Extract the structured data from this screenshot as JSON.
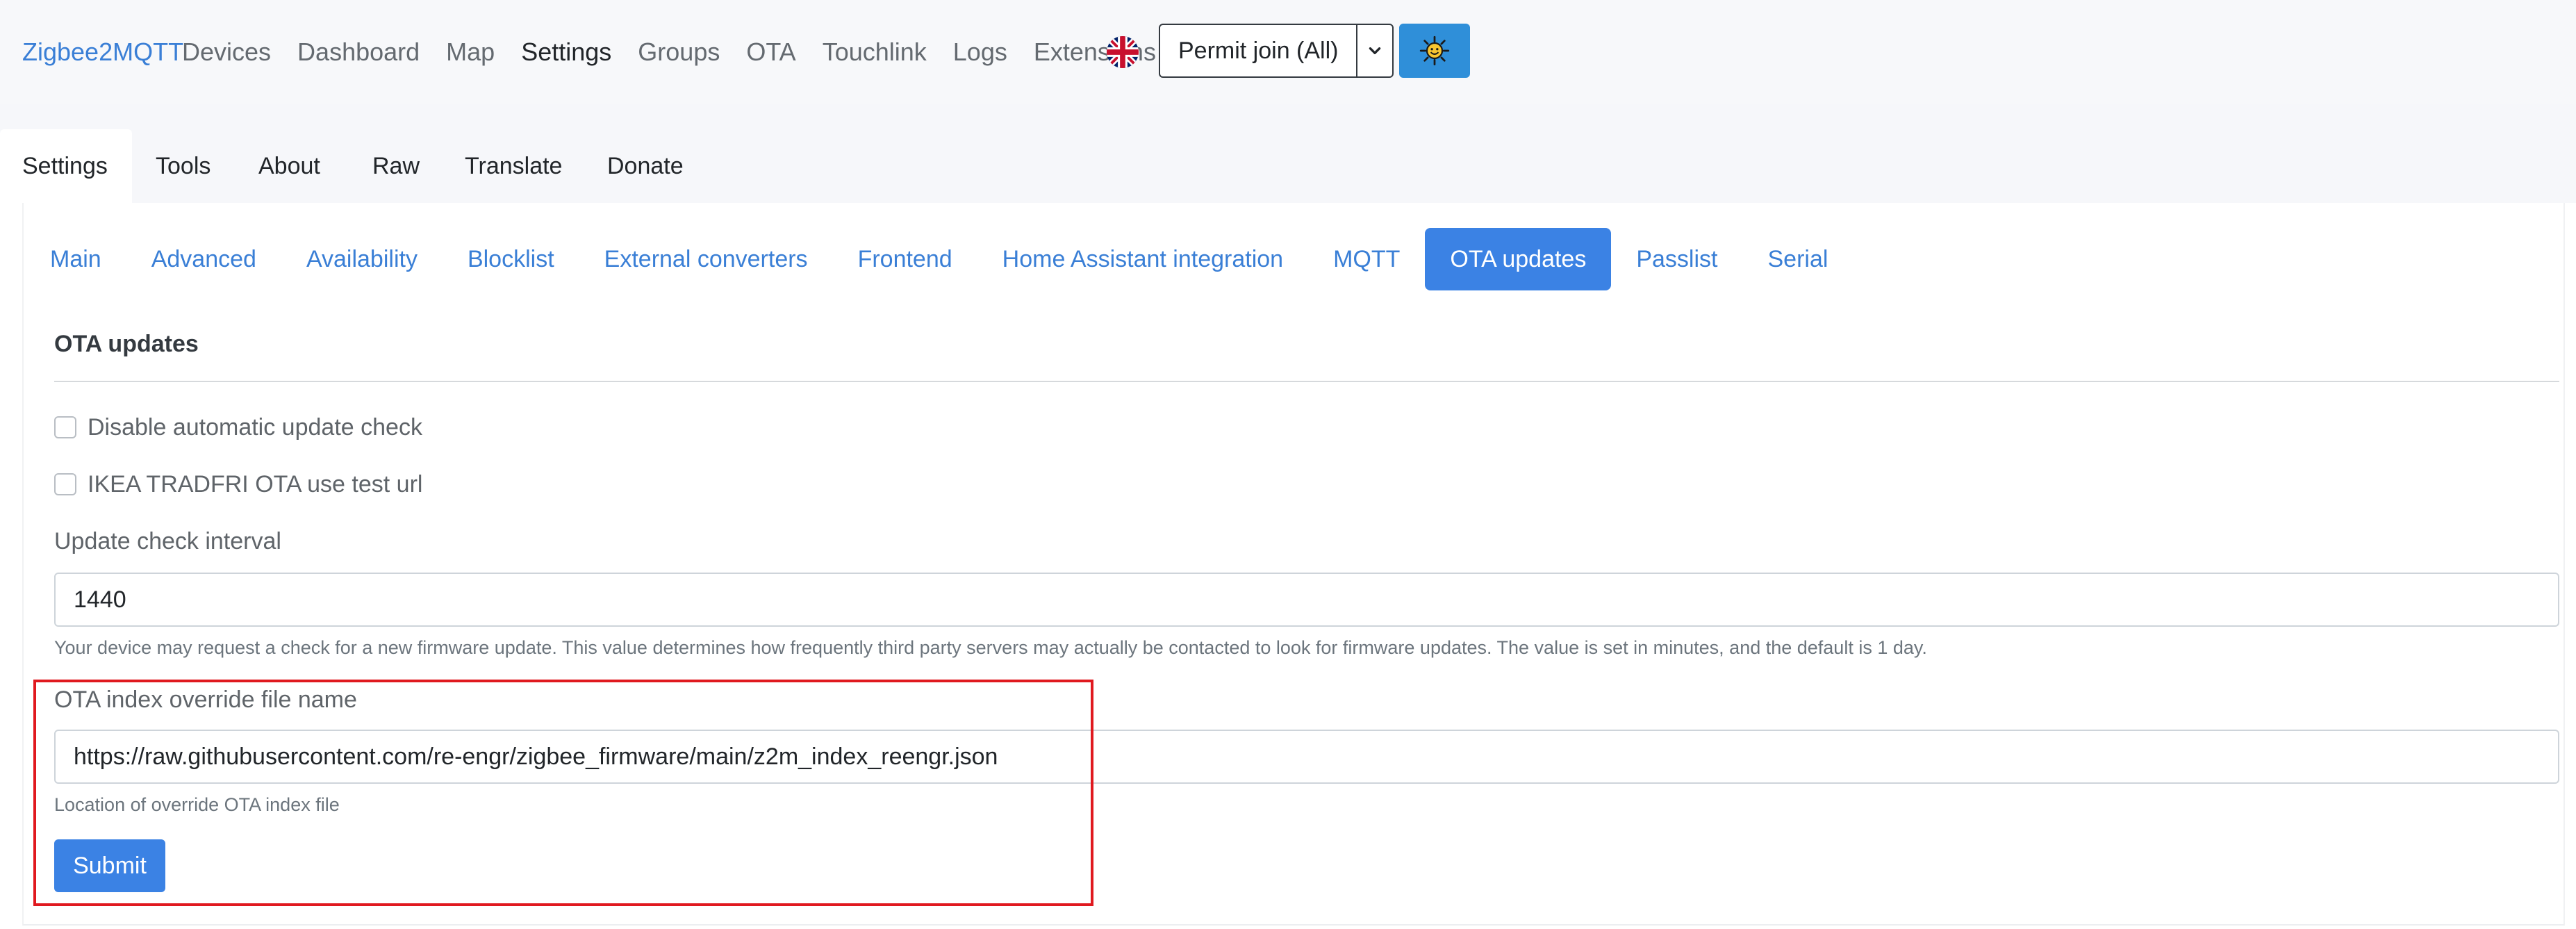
{
  "navbar": {
    "brand": "Zigbee2MQTT",
    "links": [
      "Devices",
      "Dashboard",
      "Map",
      "Settings",
      "Groups",
      "OTA",
      "Touchlink",
      "Logs",
      "Extensions"
    ],
    "active_link": "Settings",
    "language_icon": "uk-flag-icon",
    "permit_join_label": "Permit join (All)",
    "permit_join_caret_icon": "chevron-down-icon",
    "theme_icon": "sun-icon",
    "theme_button_color": "#2f8fd9"
  },
  "settings_tabs": {
    "items": [
      "Settings",
      "Tools",
      "About",
      "Raw",
      "Translate",
      "Donate"
    ],
    "active": "Settings"
  },
  "sub_tabs": {
    "items": [
      "Main",
      "Advanced",
      "Availability",
      "Blocklist",
      "External converters",
      "Frontend",
      "Home Assistant integration",
      "MQTT",
      "OTA updates",
      "Passlist",
      "Serial"
    ],
    "active": "OTA updates"
  },
  "ota": {
    "title": "OTA updates",
    "disable_check_label": "Disable automatic update check",
    "disable_check_checked": false,
    "ikea_test_label": "IKEA TRADFRI OTA use test url",
    "ikea_test_checked": false,
    "interval_label": "Update check interval",
    "interval_value": "1440",
    "interval_help": "Your device may request a check for a new firmware update. This value determines how frequently third party servers may actually be contacted to look for firmware updates. The value is set in minutes, and the default is 1 day.",
    "override_label": "OTA index override file name",
    "override_value": "https://raw.githubusercontent.com/re-engr/zigbee_firmware/main/z2m_index_reengr.json",
    "override_help": "Location of override OTA index file",
    "submit_label": "Submit"
  },
  "colors": {
    "accent": "#3b82e4",
    "link": "#3a7fd6",
    "highlight": "#e0191f"
  }
}
